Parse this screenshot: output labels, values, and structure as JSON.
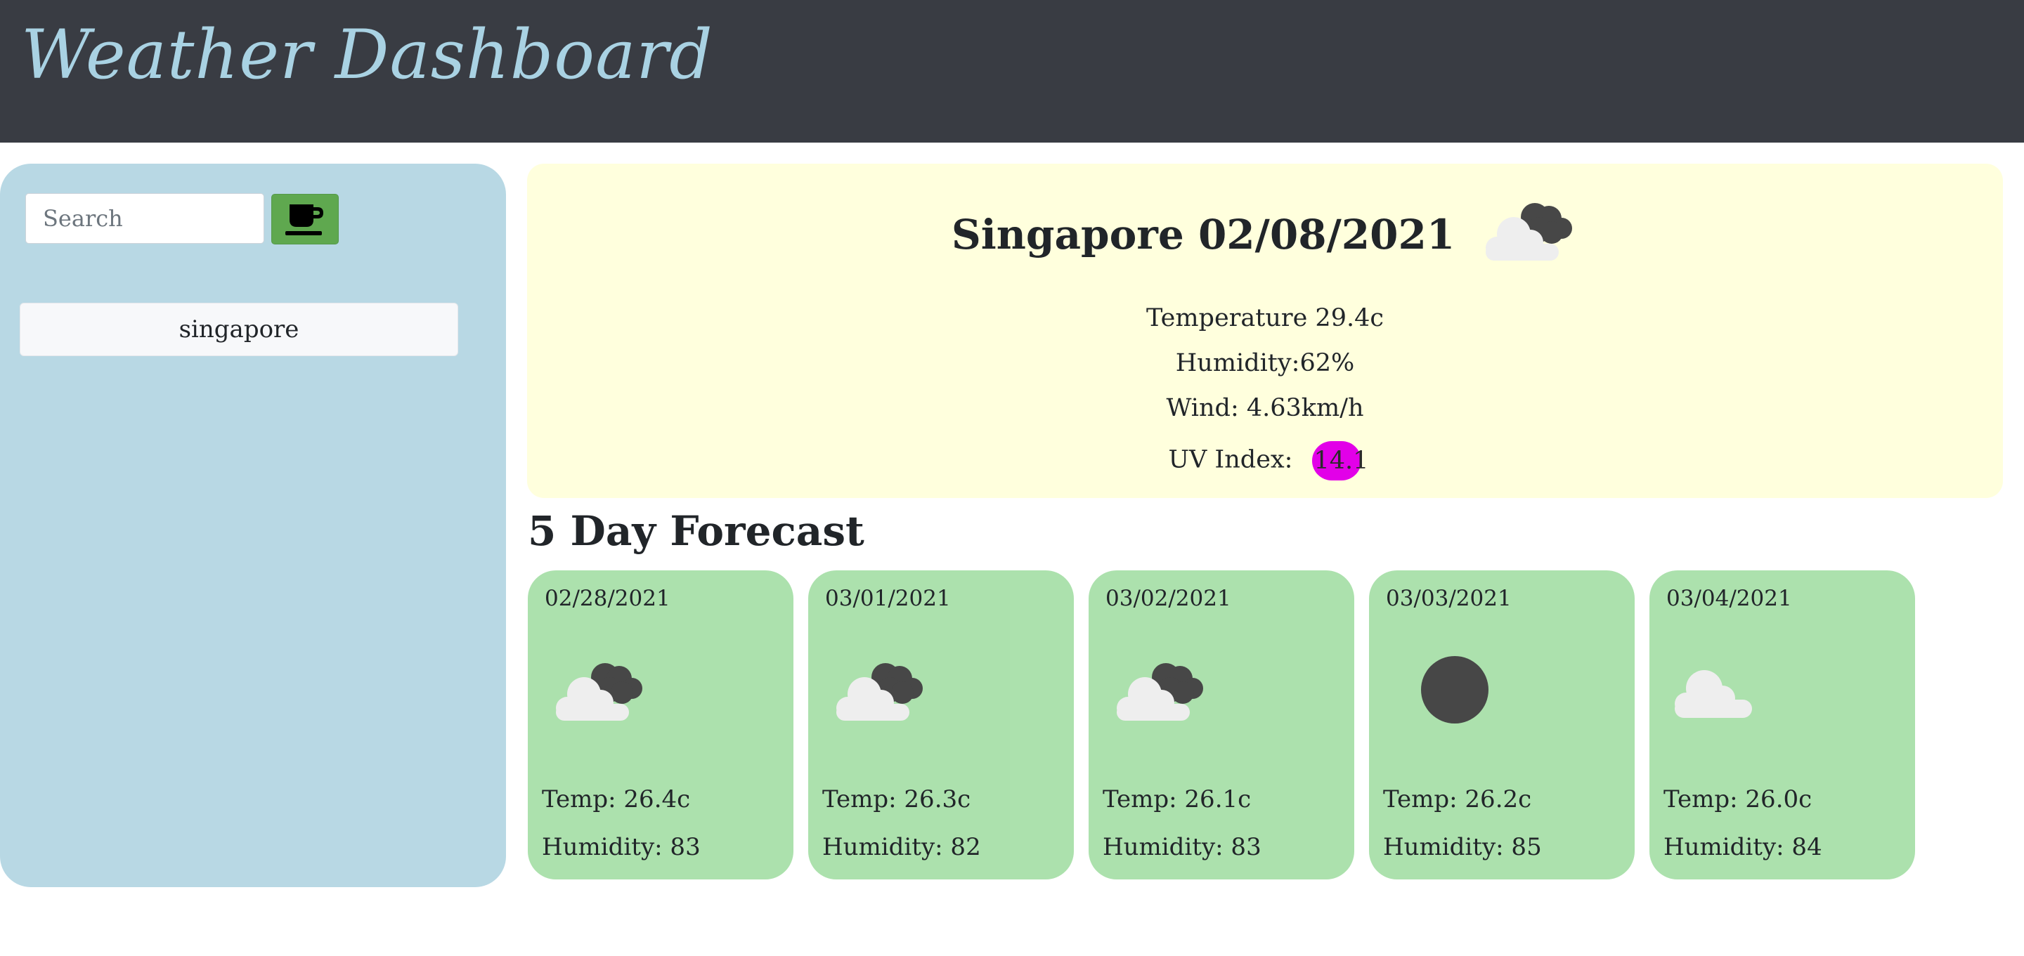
{
  "header": {
    "title": "Weather Dashboard"
  },
  "sidebar": {
    "search": {
      "placeholder": "Search",
      "value": ""
    },
    "search_button_icon": "coffee-cup-icon",
    "history": [
      "singapore"
    ]
  },
  "current": {
    "city": "Singapore",
    "date": "02/08/2021",
    "icon": "broken-clouds-icon",
    "temperature": "Temperature 29.4c",
    "humidity": "Humidity:62%",
    "wind": "Wind: 4.63km/h",
    "uv_label": "UV Index:",
    "uv_value": "14.1",
    "uv_color": "#e200e8"
  },
  "forecast": {
    "title": "5 Day Forecast",
    "days": [
      {
        "date": "02/28/2021",
        "icon": "broken-clouds-icon",
        "temp": "Temp: 26.4c",
        "humidity": "Humidity: 83"
      },
      {
        "date": "03/01/2021",
        "icon": "broken-clouds-icon",
        "temp": "Temp: 26.3c",
        "humidity": "Humidity: 82"
      },
      {
        "date": "03/02/2021",
        "icon": "broken-clouds-icon",
        "temp": "Temp: 26.1c",
        "humidity": "Humidity: 83"
      },
      {
        "date": "03/03/2021",
        "icon": "overcast-icon",
        "temp": "Temp: 26.2c",
        "humidity": "Humidity: 85"
      },
      {
        "date": "03/04/2021",
        "icon": "cloud-icon",
        "temp": "Temp: 26.0c",
        "humidity": "Humidity: 84"
      }
    ]
  },
  "colors": {
    "header_bg": "#393c43",
    "title": "#a9d2e3",
    "sidebar_bg": "#b8d8e4",
    "current_bg": "#ffffdd",
    "forecast_bg": "#ace1ad",
    "button_bg": "#5fa84f"
  }
}
